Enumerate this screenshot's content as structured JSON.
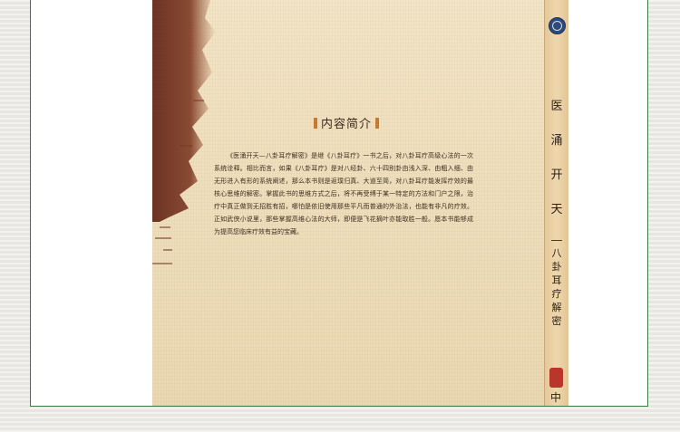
{
  "book": {
    "section_heading": "内容简介",
    "paragraph": "《医涌开天—八卦耳疗解密》是继《八卦耳疗》一书之后，对八卦耳疗高级心法的一次系统诠释。相比而言，如果《八卦耳疗》是对八经卦、六十四别卦由浅入深、由粗入细、由无形进入有形的系统阐述，那么本书则是返璞归真、大道至简，对八卦耳疗能发挥疗效的最核心思维的解密。掌握此书的思维方式之后，将不再受缚于某一特定的方法和门户之限，治疗中真正做到无招胜有招，哪怕是依旧使用那些平凡而普通的外治法，也能有非凡的疗效。正如武侠小说里，那些掌握高维心法的大师，即便是飞花摘叶亦能取胜一般。愿本书能够成为提高您临床疗效有益的宝藏。"
  },
  "spine": {
    "title_chars": [
      "医",
      "涌",
      "开",
      "天",
      "—"
    ],
    "subtitle_chars": [
      "八",
      "卦",
      "耳",
      "疗",
      "解",
      "密"
    ],
    "publisher_char": "中"
  },
  "colors": {
    "frame_border": "#3d7a45",
    "accent_bar": "#c97a2a",
    "paper": "#efdfbd",
    "brush": "#7a3a2a",
    "seal": "#b9362a",
    "emblem": "#2c4a82"
  }
}
